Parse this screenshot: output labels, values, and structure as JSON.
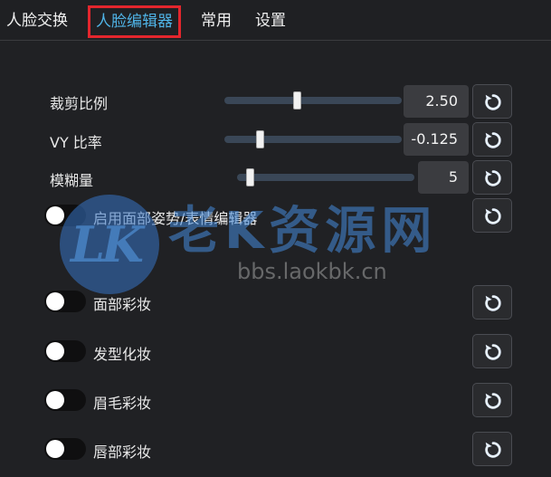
{
  "tabs": [
    {
      "label": "人脸交换",
      "active": false
    },
    {
      "label": "人脸编辑器",
      "active": true
    },
    {
      "label": "常用",
      "active": false
    },
    {
      "label": "设置",
      "active": false
    }
  ],
  "sliders": [
    {
      "label": "裁剪比例",
      "value": "2.50",
      "fraction": 0.41
    },
    {
      "label": "VY 比率",
      "value": "-0.125",
      "fraction": 0.2
    },
    {
      "label": "模糊量",
      "value": "5",
      "fraction": 0.07
    }
  ],
  "toggles": [
    {
      "label": "启用面部姿势/表情编辑器",
      "on": false
    },
    {
      "label": "面部彩妆",
      "on": false
    },
    {
      "label": "发型化妆",
      "on": false
    },
    {
      "label": "眉毛彩妆",
      "on": false
    },
    {
      "label": "唇部彩妆",
      "on": false
    }
  ],
  "watermark": {
    "logo": "LK",
    "title": "老K资源网",
    "url": "bbs.laokbk.cn"
  },
  "colors": {
    "accent": "#4fb3e6",
    "highlight_border": "#e3262d",
    "background": "#202124"
  },
  "icons": {
    "reset": "refresh-icon"
  }
}
